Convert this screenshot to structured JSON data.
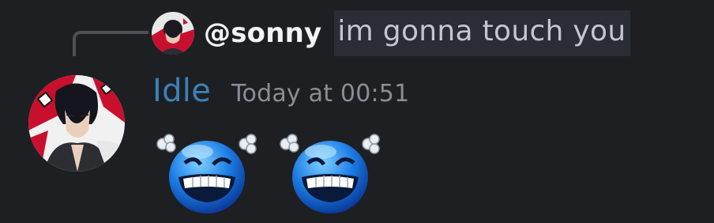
{
  "reply": {
    "author": "@sonny",
    "text": "im gonna touch you",
    "avatar_icon": "anime-character-avatar-icon"
  },
  "message": {
    "author": "Idle",
    "timestamp": "Today at 00:51",
    "author_color": "#3b82b8",
    "avatar_icon": "anime-character-avatar-icon",
    "emojis": [
      {
        "icon": "blue-laughing-steam-emoji-icon"
      },
      {
        "icon": "blue-laughing-steam-emoji-icon"
      }
    ]
  },
  "colors": {
    "background": "#1e1f23",
    "highlight": "#2b2d35"
  }
}
